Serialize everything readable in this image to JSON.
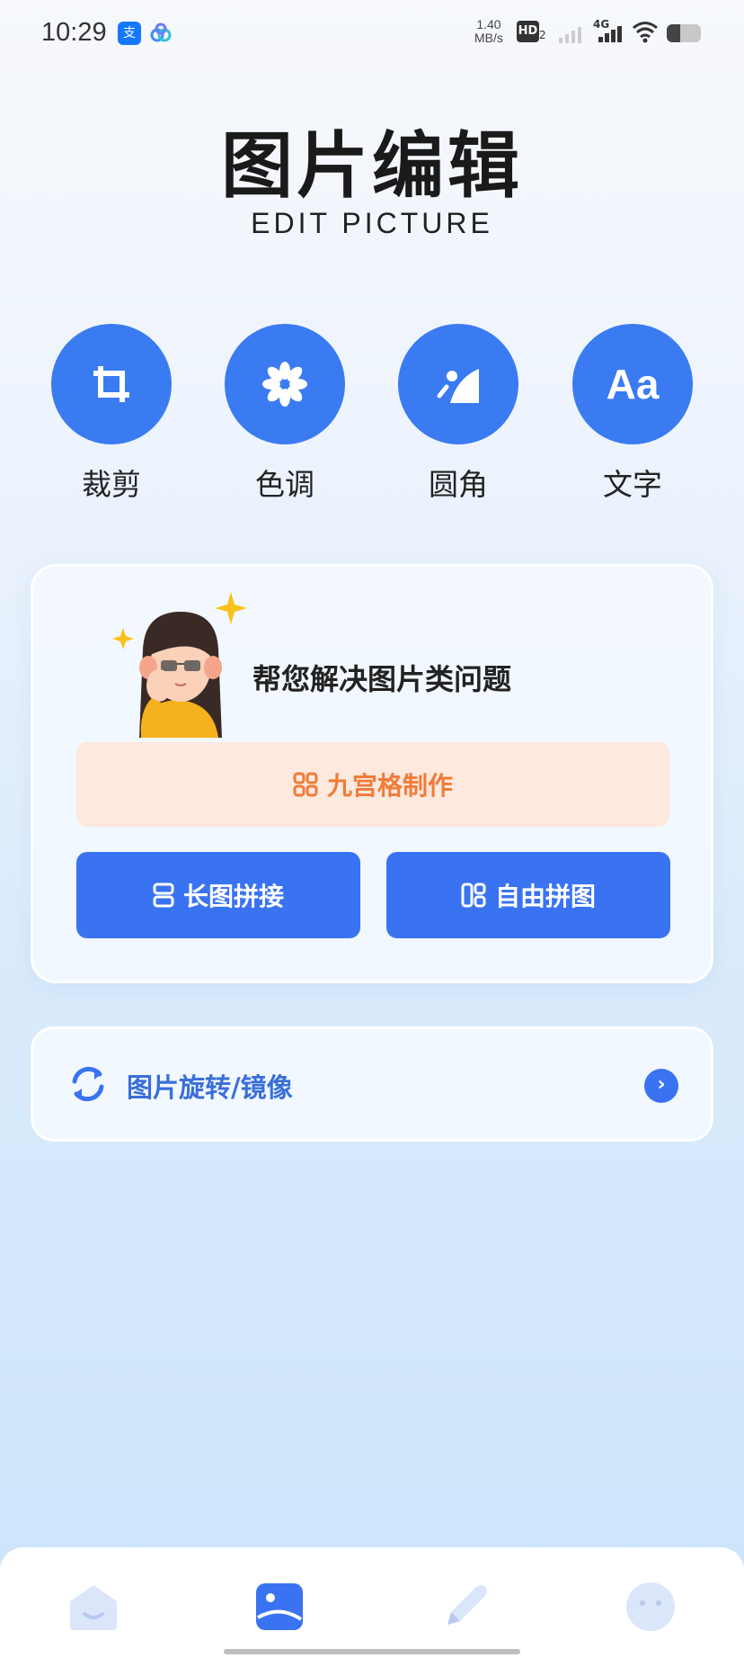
{
  "status_bar": {
    "time": "10:29",
    "net_speed_value": "1.40",
    "net_speed_unit": "MB/s",
    "hd_label": "HD",
    "hd_sub": "2",
    "network_type": "4G",
    "alipay_glyph": "支"
  },
  "header": {
    "title": "图片编辑",
    "subtitle": "EDIT PICTURE"
  },
  "tools": [
    {
      "label": "裁剪",
      "icon": "crop-icon"
    },
    {
      "label": "色调",
      "icon": "flower-icon"
    },
    {
      "label": "圆角",
      "icon": "round-corner-icon"
    },
    {
      "label": "文字",
      "icon": "text-icon",
      "glyph": "Aa"
    }
  ],
  "card": {
    "headline": "帮您解决图片类问题",
    "nine_grid_label": "九宫格制作",
    "long_stitch_label": "长图拼接",
    "free_collage_label": "自由拼图"
  },
  "rotate_row": {
    "label": "图片旋转/镜像",
    "arrow": "›"
  },
  "colors": {
    "accent": "#3a73f2",
    "orange": "#f07b3a",
    "orange_bg": "#fde9dd"
  },
  "tabbar": [
    {
      "icon": "home-icon",
      "active": false
    },
    {
      "icon": "image-edit-icon",
      "active": true
    },
    {
      "icon": "pencil-icon",
      "active": false
    },
    {
      "icon": "smiley-icon",
      "active": false
    }
  ]
}
